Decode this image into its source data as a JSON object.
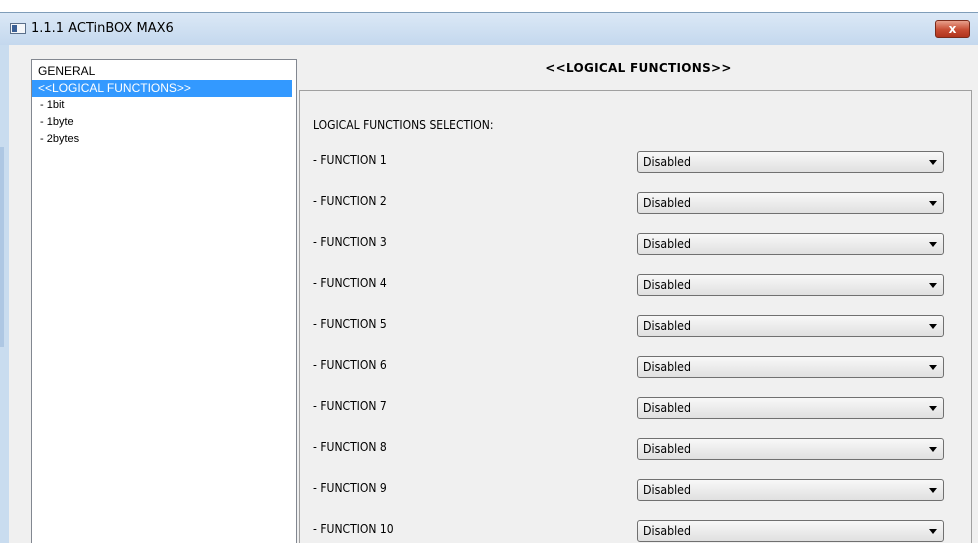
{
  "window": {
    "title": "1.1.1 ACTinBOX MAX6",
    "close_label": "x"
  },
  "tree": {
    "items": [
      {
        "label": "GENERAL",
        "level": 0
      },
      {
        "label": "<<LOGICAL FUNCTIONS>>",
        "level": 0,
        "selected": true
      },
      {
        "label": "- 1bit",
        "level": 1
      },
      {
        "label": "- 1byte",
        "level": 1
      },
      {
        "label": "- 2bytes",
        "level": 1
      }
    ]
  },
  "main": {
    "section_title": "<<LOGICAL FUNCTIONS>>",
    "selection_label": "LOGICAL FUNCTIONS SELECTION:",
    "functions": [
      {
        "label": "- FUNCTION 1",
        "value": "Disabled"
      },
      {
        "label": "- FUNCTION 2",
        "value": "Disabled"
      },
      {
        "label": "- FUNCTION 3",
        "value": "Disabled"
      },
      {
        "label": "- FUNCTION 4",
        "value": "Disabled"
      },
      {
        "label": "- FUNCTION 5",
        "value": "Disabled"
      },
      {
        "label": "- FUNCTION 6",
        "value": "Disabled"
      },
      {
        "label": "- FUNCTION 7",
        "value": "Disabled"
      },
      {
        "label": "- FUNCTION 8",
        "value": "Disabled"
      },
      {
        "label": "- FUNCTION 9",
        "value": "Disabled"
      },
      {
        "label": "- FUNCTION 10",
        "value": "Disabled"
      }
    ]
  },
  "colors": {
    "selection": "#3399ff",
    "close_button": "#c74c33",
    "title_bar": "#c9dcef"
  }
}
